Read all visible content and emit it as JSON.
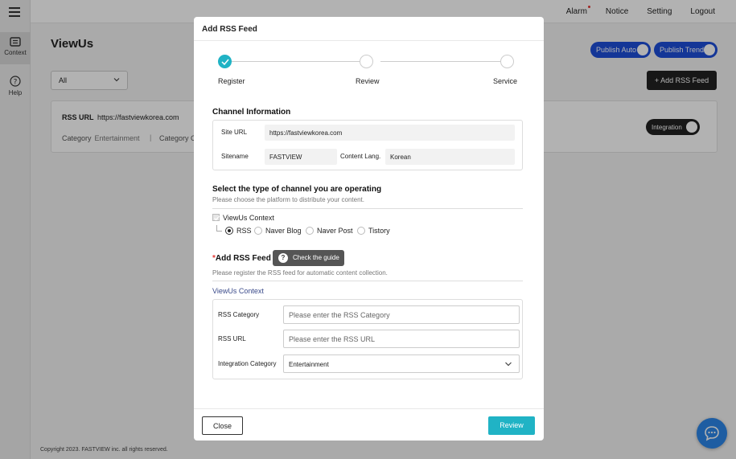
{
  "sidebar": {
    "items": [
      {
        "label": "Context",
        "icon": "list-icon"
      },
      {
        "label": "Help",
        "icon": "question-icon"
      }
    ]
  },
  "topnav": {
    "alarm": "Alarm",
    "notice": "Notice",
    "setting": "Setting",
    "logout": "Logout"
  },
  "main": {
    "brand": "ViewUs",
    "filter_value": "All",
    "publish_auto": "Publish Auto",
    "publish_trends": "Publish Trends",
    "add_feed": "+ Add RSS Feed",
    "card": {
      "rss_label": "RSS URL",
      "rss_url": "https://fastviewkorea.com",
      "category_label": "Category",
      "category_value": "Entertainment",
      "separator": "|",
      "category2_label": "Category C",
      "integration": "Integration"
    },
    "footer": "Copyright  2023. FASTVIEW inc. all rights reserved."
  },
  "modal": {
    "title": "Add RSS Feed",
    "steps": [
      "Register",
      "Review",
      "Service"
    ],
    "channel_info": {
      "title": "Channel Information",
      "site_url_label": "Site URL",
      "site_url": "https://fastviewkorea.com",
      "sitename_label": "Sitename",
      "sitename": "FASTVIEW",
      "lang_label": "Content Lang.",
      "lang": "Korean"
    },
    "channel_type": {
      "title": "Select the type of channel you are operating",
      "subtitle": "Please choose the platform to distribute your content.",
      "checkbox_label": "ViewUs Context",
      "options": [
        "RSS",
        "Naver Blog",
        "Naver Post",
        "Tistory"
      ],
      "selected": "RSS"
    },
    "rss_feed": {
      "required_mark": "*",
      "title": "Add RSS Feed",
      "guide_button": "Check the guide",
      "subtitle": "Please register the RSS feed for automatic content collection.",
      "context_title": "ViewUs Context",
      "category_label": "RSS Category",
      "category_placeholder": "Please enter the RSS Category",
      "url_label": "RSS URL",
      "url_placeholder": "Please enter the RSS URL",
      "integration_label": "Integration Category",
      "integration_value": "Entertainment"
    },
    "footer": {
      "close": "Close",
      "review": "Review"
    }
  },
  "colors": {
    "accent": "#20b3c5",
    "publish_blue": "#1d4ed8",
    "chat_blue": "#2b86e8"
  }
}
